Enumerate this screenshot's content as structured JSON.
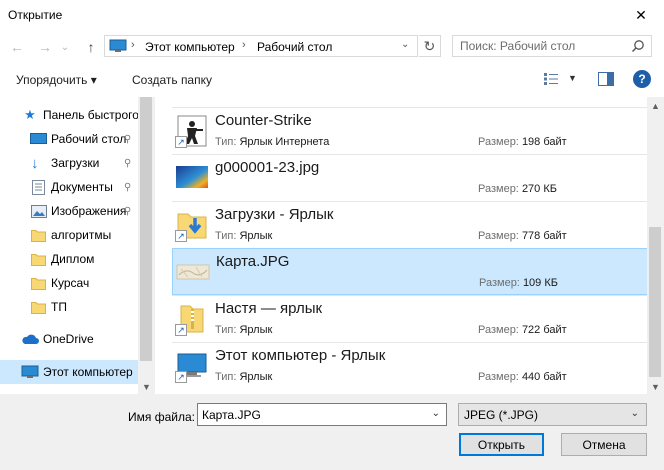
{
  "window": {
    "title": "Открытие",
    "close_glyph": "✕"
  },
  "nav": {
    "back_glyph": "←",
    "forward_glyph": "→",
    "history_glyph": "⌄",
    "up_glyph": "↑",
    "breadcrumb": [
      "Этот компьютер",
      "Рабочий стол"
    ],
    "breadcrumb_sep": "›",
    "address_dropdown_glyph": "⌄",
    "refresh_glyph": "↻",
    "search_placeholder": "Поиск: Рабочий стол"
  },
  "toolbar": {
    "organize_label": "Упорядочить ▾",
    "new_folder_label": "Создать папку",
    "view_dropdown_glyph": "▼",
    "help_glyph": "?"
  },
  "sidebar": {
    "items": [
      {
        "label": "Панель быстрого доступа",
        "icon": "star-icon",
        "pinned": false
      },
      {
        "label": "Рабочий стол",
        "icon": "desktop-icon",
        "pinned": true
      },
      {
        "label": "Загрузки",
        "icon": "download-icon",
        "pinned": true
      },
      {
        "label": "Документы",
        "icon": "documents-icon",
        "pinned": true
      },
      {
        "label": "Изображения",
        "icon": "pictures-icon",
        "pinned": true
      },
      {
        "label": "алгоритмы",
        "icon": "folder-icon",
        "pinned": false
      },
      {
        "label": "Диплом",
        "icon": "folder-icon",
        "pinned": false
      },
      {
        "label": "Курсач",
        "icon": "folder-icon",
        "pinned": false
      },
      {
        "label": "ТП",
        "icon": "folder-icon",
        "pinned": false
      },
      {
        "label": "OneDrive",
        "icon": "cloud-icon",
        "pinned": false
      },
      {
        "label": "Этот компьютер",
        "icon": "computer-icon",
        "pinned": false,
        "selected": true
      }
    ],
    "pin_glyph": "📌"
  },
  "files": {
    "type_key": "Тип:",
    "size_key": "Размер:",
    "items": [
      {
        "name": "Counter-Strike",
        "type": "Ярлык Интернета",
        "size": "198 байт",
        "icon": "counter-strike-icon",
        "shortcut": true
      },
      {
        "name": "g000001-23.jpg",
        "type": "",
        "size": "270 КБ",
        "icon": "image-thumbnail-icon",
        "shortcut": false
      },
      {
        "name": "Загрузки - Ярлык",
        "type": "Ярлык",
        "size": "778 байт",
        "icon": "downloads-folder-icon",
        "shortcut": true
      },
      {
        "name": "Карта.JPG",
        "type": "",
        "size": "109 КБ",
        "icon": "map-thumbnail-icon",
        "shortcut": false,
        "selected": true
      },
      {
        "name": "Настя — ярлык",
        "type": "Ярлык",
        "size": "722 байт",
        "icon": "folder-zip-icon",
        "shortcut": true
      },
      {
        "name": "Этот компьютер - Ярлык",
        "type": "Ярлык",
        "size": "440 байт",
        "icon": "computer-icon",
        "shortcut": true
      }
    ],
    "shortcut_glyph": "↗"
  },
  "scrollbars": {
    "up_glyph": "▲",
    "down_glyph": "▼"
  },
  "footer": {
    "filename_label": "Имя файла:",
    "filename_value": "Карта.JPG",
    "filename_dropdown_glyph": "⌄",
    "filetype_value": "JPEG (*.JPG)",
    "filetype_dropdown_glyph": "⌄",
    "open_label": "Открыть",
    "cancel_label": "Отмена"
  },
  "colors": {
    "selection": "#cce8ff",
    "selection_border": "#99d1ff",
    "folder": "#f8d775",
    "accent": "#0078d7"
  }
}
